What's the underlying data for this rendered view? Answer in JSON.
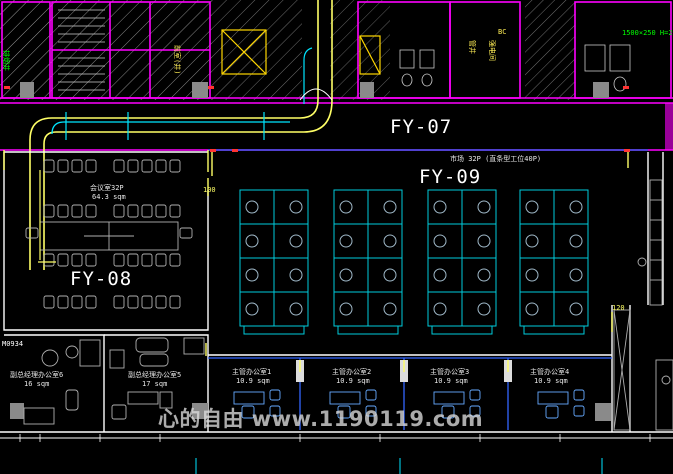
{
  "zones": {
    "fy07": "FY-07",
    "fy08": "FY-08",
    "fy09": "FY-09"
  },
  "rooms": {
    "meeting": {
      "name": "会议室32P",
      "area": "64.3 sqm"
    },
    "open_office": {
      "name": "市场 32P (直条型工位40P)"
    },
    "deputy_gm_6": {
      "name": "副总经理办公室6",
      "area": "16 sqm"
    },
    "deputy_gm_5": {
      "name": "副总经理办公室5",
      "area": "17 sqm"
    },
    "manager_1": {
      "name": "主管办公室1",
      "area": "10.9 sqm"
    },
    "manager_2": {
      "name": "主管办公室2",
      "area": "10.9 sqm"
    },
    "manager_3": {
      "name": "主管办公室3",
      "area": "10.9 sqm"
    },
    "manager_4": {
      "name": "主管办公室4",
      "area": "10.9 sqm"
    }
  },
  "tags": {
    "door_a": "100",
    "door_b": "120",
    "door_c": "M0934",
    "duct_size": "1500×250 H=2"
  },
  "watermark": "心的自由 www.1190119.com",
  "colors": {
    "background": "#000000",
    "wall": "#ffffff",
    "partition_magenta": "#ff00ff",
    "duct_yellow": "#ffff66",
    "hvac_cyan": "#00e5ff",
    "blue_line": "#3366ff",
    "furniture_grey": "#b0b0b0"
  }
}
